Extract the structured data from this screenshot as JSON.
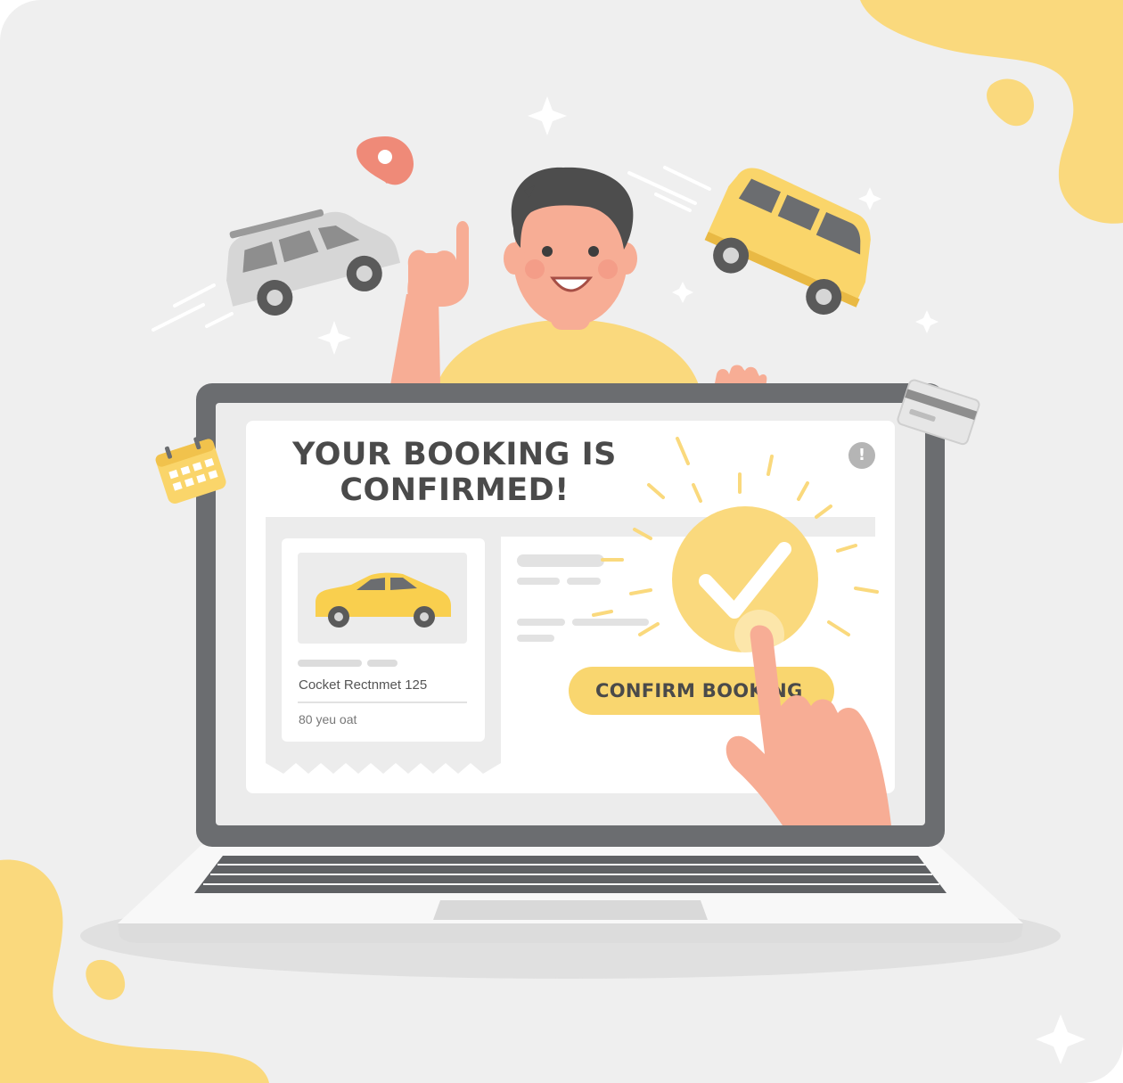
{
  "confirmation": {
    "headline_line1": "YOUR BOOKING IS",
    "headline_line2": "CONFIRMED!"
  },
  "booking_card": {
    "car_name": "Cocket Rectnmet 125",
    "car_subtitle": "80 yeu oat"
  },
  "actions": {
    "confirm_label": "CONFIRM BOOKING",
    "info_glyph": "!"
  },
  "colors": {
    "accent_yellow": "#f9d66f",
    "background": "#efefef",
    "laptop_frame": "#6b6d70",
    "skin": "#f7ad95",
    "pin_red": "#ef8a78"
  },
  "icons": [
    "location-pin-icon",
    "sparkle-icon",
    "calendar-icon",
    "credit-card-icon",
    "check-badge-icon",
    "info-icon"
  ]
}
